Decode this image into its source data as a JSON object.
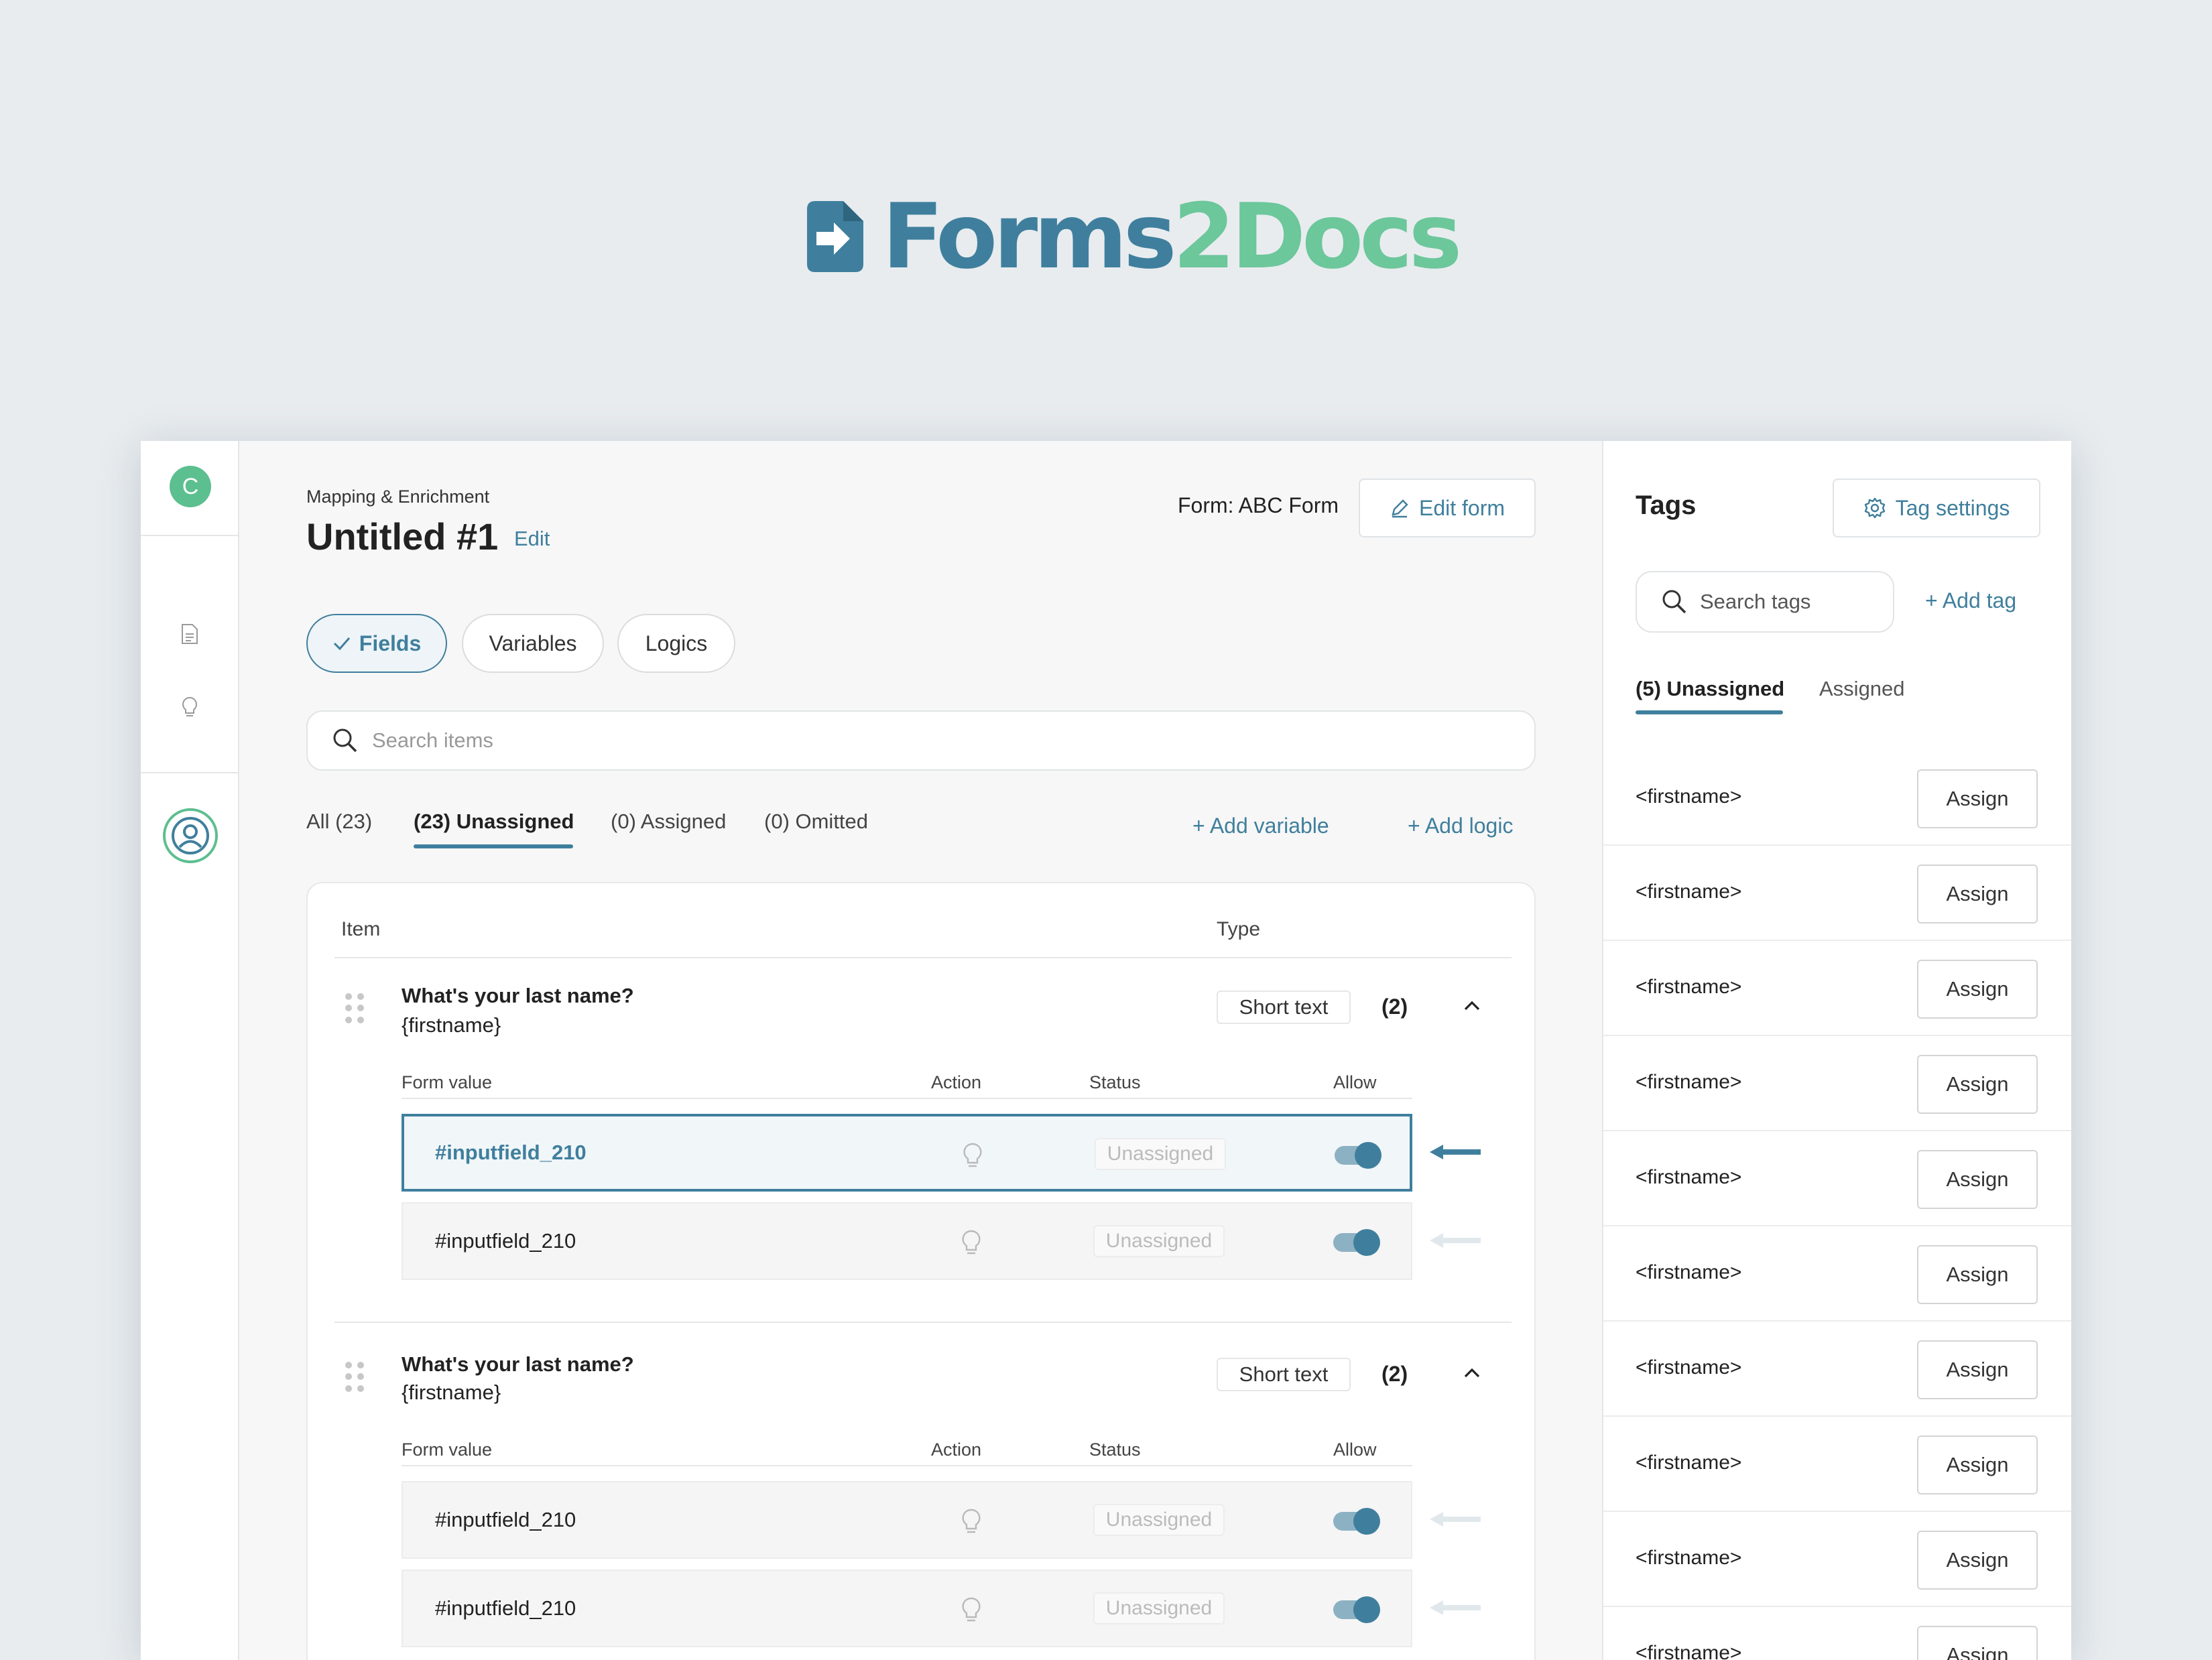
{
  "brand": {
    "name_part1": "Forms",
    "name_part2": "2Docs",
    "color_primary": "#3f7f9d",
    "color_accent": "#6cc79b"
  },
  "rail": {
    "avatar_letter": "C",
    "icons": [
      "document-icon",
      "lightbulb-icon",
      "user-circle-icon"
    ]
  },
  "header": {
    "breadcrumb": "Mapping & Enrichment",
    "title": "Untitled #1",
    "edit_link": "Edit",
    "form_label": "Form: ABC Form",
    "edit_form_button": "Edit form"
  },
  "segments": [
    {
      "label": "Fields",
      "active": true
    },
    {
      "label": "Variables",
      "active": false
    },
    {
      "label": "Logics",
      "active": false
    }
  ],
  "search": {
    "placeholder": "Search items"
  },
  "filter_tabs": [
    {
      "label": "All (23)",
      "active": false
    },
    {
      "label": "(23) Unassigned",
      "active": true
    },
    {
      "label": "(0) Assigned",
      "active": false
    },
    {
      "label": "(0) Omitted",
      "active": false
    }
  ],
  "actions": {
    "add_variable": "+ Add variable",
    "add_logic": "+ Add logic"
  },
  "table": {
    "col_item": "Item",
    "col_type": "Type",
    "sub_headers": {
      "form_value": "Form value",
      "action": "Action",
      "status": "Status",
      "allow": "Allow"
    },
    "groups": [
      {
        "question": "What's your last name?",
        "variable": "{firstname}",
        "type": "Short text",
        "count": "(2)",
        "rows": [
          {
            "name": "#inputfield_210",
            "status": "Unassigned",
            "allow": true,
            "selected": true
          },
          {
            "name": "#inputfield_210",
            "status": "Unassigned",
            "allow": true,
            "selected": false
          }
        ]
      },
      {
        "question": "What's your last name?",
        "variable": "{firstname}",
        "type": "Short text",
        "count": "(2)",
        "rows": [
          {
            "name": "#inputfield_210",
            "status": "Unassigned",
            "allow": true,
            "selected": false
          },
          {
            "name": "#inputfield_210",
            "status": "Unassigned",
            "allow": true,
            "selected": false
          }
        ]
      }
    ]
  },
  "tags_panel": {
    "title": "Tags",
    "settings_button": "Tag settings",
    "search_placeholder": "Search tags",
    "add_tag": "+ Add tag",
    "tabs": [
      {
        "label": "(5) Unassigned",
        "active": true
      },
      {
        "label": "Assigned",
        "active": false
      }
    ],
    "assign_label": "Assign",
    "items": [
      "<firstname>",
      "<firstname>",
      "<firstname>",
      "<firstname>",
      "<firstname>",
      "<firstname>",
      "<firstname>",
      "<firstname>",
      "<firstname>",
      "<firstname>"
    ]
  }
}
